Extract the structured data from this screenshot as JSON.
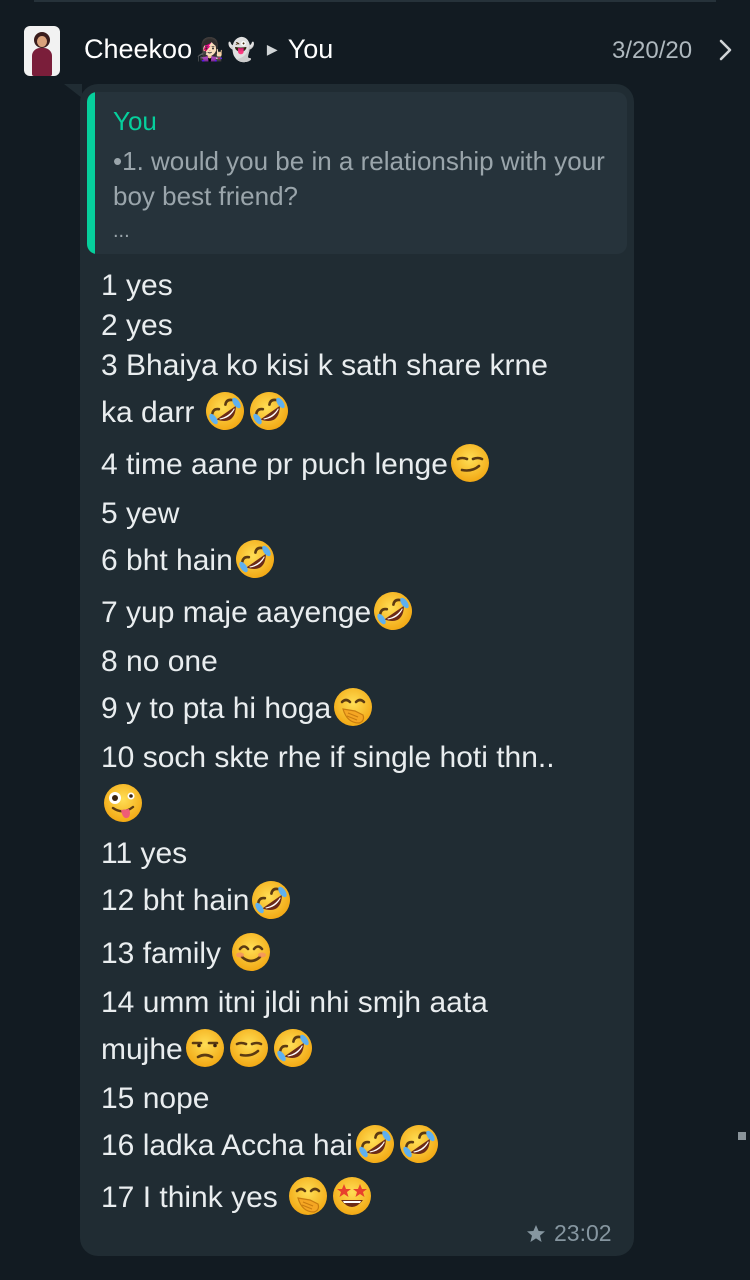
{
  "header": {
    "sender": "Cheekoo",
    "sender_emojis": [
      "👩🏻‍🎤",
      "👻"
    ],
    "recipient": "You",
    "date": "3/20/20"
  },
  "quote": {
    "author": "You",
    "text": "•1. would you be in a relationship with your  boy best friend?",
    "more": "..."
  },
  "message": {
    "lines": {
      "l1": "1 yes",
      "l2": "2 yes",
      "l3a": "3 Bhaiya ko kisi k sath share krne",
      "l3b": "ka darr ",
      "l4": "4 time aane pr puch lenge",
      "l5": "5 yew",
      "l6": "6 bht hain",
      "l7": "7 yup maje aayenge",
      "l8": "8 no one",
      "l9": "9 y to pta hi hoga",
      "l10": "10 soch skte rhe if single hoti thn..",
      "l11": "11 yes",
      "l12": "12 bht hain",
      "l13": "13 family ",
      "l14a": "14 umm itni jldi nhi smjh aata",
      "l14b": "mujhe",
      "l15": "15 nope",
      "l16": "16 ladka Accha hai",
      "l17": "17 I think yes "
    },
    "time": "23:02",
    "starred": true
  },
  "emoji_names": {
    "rofl": "rolling-on-floor-laughing",
    "smirk": "smirking-face",
    "hand_over_mouth": "face-with-hand-over-mouth",
    "zany": "zany-face",
    "smile": "smiling-face-with-smiling-eyes",
    "unamused": "unamused-face",
    "star_struck": "star-struck"
  },
  "colors": {
    "background": "#121b22",
    "bubble": "#202c33",
    "quote_accent": "#06cf9c",
    "emoji_yellow": "#fcc21b"
  }
}
